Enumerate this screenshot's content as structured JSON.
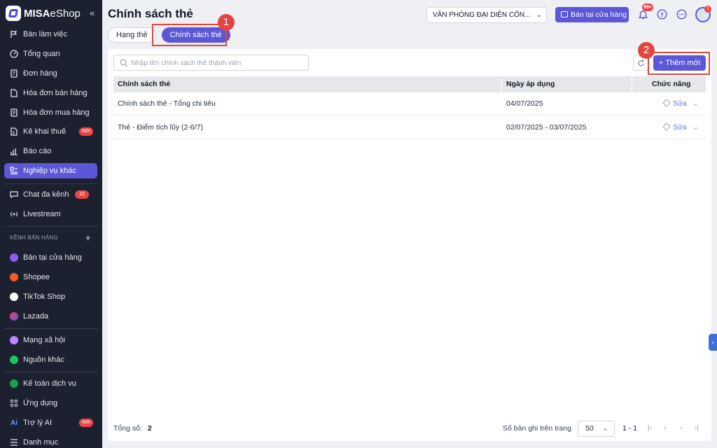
{
  "brand": {
    "name_bold": "MISA",
    "name_rest": "eShop"
  },
  "sidebar": {
    "collapse": "«",
    "items": [
      {
        "label": "Bàn làm việc"
      },
      {
        "label": "Tổng quan"
      },
      {
        "label": "Đơn hàng"
      },
      {
        "label": "Hóa đơn bán hàng"
      },
      {
        "label": "Hóa đơn mua hàng"
      },
      {
        "label": "Kê khai thuế",
        "badge": "Mới"
      },
      {
        "label": "Báo cáo"
      },
      {
        "label": "Nghiệp vụ khác",
        "active": true
      },
      {
        "label": "Chat đa kênh",
        "badge": "12"
      },
      {
        "label": "Livestream"
      }
    ],
    "channels_title": "KÊNH BÁN HÀNG",
    "channels_add": "+",
    "channels": [
      {
        "label": "Bán tại cửa hàng",
        "color": "#8b5cf6"
      },
      {
        "label": "Shopee",
        "color": "#f05d23"
      },
      {
        "label": "TikTok Shop",
        "color": "#ffffff"
      },
      {
        "label": "Lazada",
        "color": "#5b57d6"
      },
      {
        "label": "Mạng xã hội",
        "color": "#c084fc"
      },
      {
        "label": "Nguồn khác",
        "color": "#22c55e"
      }
    ],
    "extras": [
      {
        "label": "Kế toán dịch vụ"
      },
      {
        "label": "Ứng dụng"
      },
      {
        "label": "Trợ lý AI",
        "badge": "Mới",
        "icon_text": "Ai"
      },
      {
        "label": "Danh mục"
      }
    ]
  },
  "header": {
    "title": "Chính sách thẻ",
    "branch": "VĂN PHÒNG ĐẠI DIỆN CÔN...",
    "pos_button": "Bán tại cửa hàng",
    "notif_badge": "99+",
    "avatar_badge": "1"
  },
  "tabs": [
    {
      "label": "Hạng thẻ"
    },
    {
      "label": "Chính sách thẻ",
      "active": true
    }
  ],
  "callouts": {
    "one": "1",
    "two": "2"
  },
  "search": {
    "placeholder": "Nhập tên chính sách thẻ thành viên"
  },
  "toolbar": {
    "add_label": "Thêm mới"
  },
  "table": {
    "headers": [
      "Chính sách thẻ",
      "Ngày áp dụng",
      "Chức năng"
    ],
    "rows": [
      {
        "name": "Chính sách thẻ - Tổng chi tiêu",
        "date": "04/07/2025",
        "action": "Sửa"
      },
      {
        "name": "Thẻ - Điểm tích lũy (2-6/7)",
        "date": "02/07/2025 - 03/07/2025",
        "action": "Sửa"
      }
    ]
  },
  "footer": {
    "total_label": "Tổng số:",
    "total_value": "2",
    "per_page_label": "Số bản ghi trên trang",
    "per_page": "50",
    "range": "1 - 1"
  },
  "colors": {
    "accent": "#5b57d6",
    "sidebar_bg": "#1c2130",
    "callout": "#e3453f",
    "badge": "#ef4444"
  }
}
